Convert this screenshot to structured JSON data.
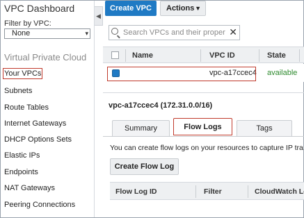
{
  "sidebar": {
    "title": "VPC Dashboard",
    "filter_label": "Filter by VPC:",
    "filter_value": "None",
    "section_title": "Virtual Private Cloud",
    "items": [
      {
        "label": "Your VPCs",
        "active": true
      },
      {
        "label": "Subnets"
      },
      {
        "label": "Route Tables"
      },
      {
        "label": "Internet Gateways"
      },
      {
        "label": "DHCP Options Sets"
      },
      {
        "label": "Elastic IPs"
      },
      {
        "label": "Endpoints"
      },
      {
        "label": "NAT Gateways"
      },
      {
        "label": "Peering Connections"
      }
    ]
  },
  "toolbar": {
    "create_label": "Create VPC",
    "actions_label": "Actions"
  },
  "search": {
    "placeholder": "Search VPCs and their proper"
  },
  "table": {
    "columns": [
      "Name",
      "VPC ID",
      "State"
    ],
    "rows": [
      {
        "name": "",
        "vpc_id": "vpc-a17ccec4",
        "state": "available",
        "selected": true
      }
    ]
  },
  "detail": {
    "title": "vpc-a17ccec4 (172.31.0.0/16)",
    "tabs": [
      {
        "label": "Summary"
      },
      {
        "label": "Flow Logs",
        "active": true
      },
      {
        "label": "Tags"
      }
    ],
    "info_text": "You can create flow logs on your resources to capture IP tra",
    "create_flow_log_label": "Create Flow Log",
    "flow_log_columns": [
      "Flow Log ID",
      "Filter",
      "CloudWatch Lo"
    ]
  },
  "colors": {
    "primary_button": "#1f7ac4",
    "highlight_outline": "#c0392b",
    "state_available": "#2d8a2d"
  }
}
